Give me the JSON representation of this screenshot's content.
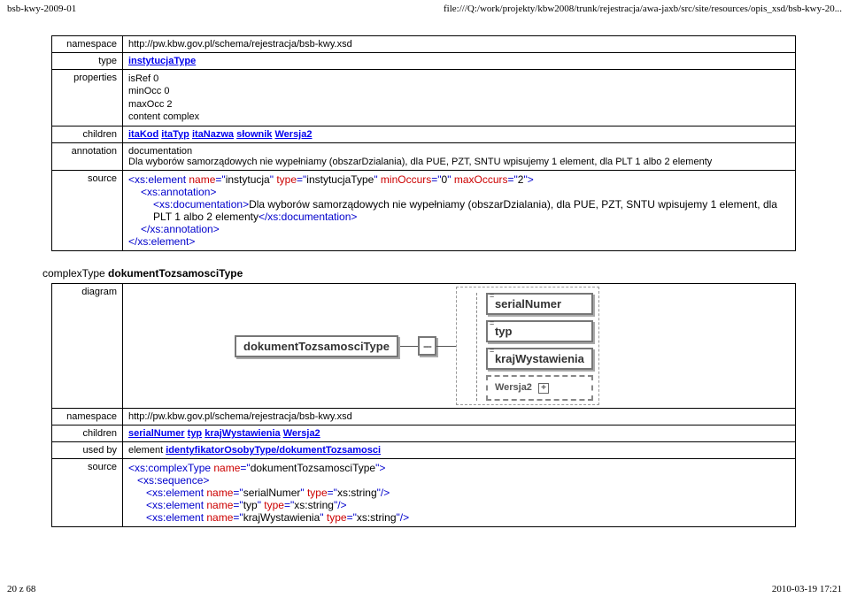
{
  "header": {
    "left": "bsb-kwy-2009-01",
    "right": "file:///Q:/work/projekty/kbw2008/trunk/rejestracja/awa-jaxb/src/site/resources/opis_xsd/bsb-kwy-20..."
  },
  "row1": {
    "label": "namespace",
    "value": "http://pw.kbw.gov.pl/schema/rejestracja/bsb-kwy.xsd"
  },
  "row2": {
    "label": "type",
    "value": "instytucjaType"
  },
  "row3": {
    "label": "properties",
    "p1": "isRef 0",
    "p2": "minOcc 0",
    "p3": "maxOcc 2",
    "p4": "content complex"
  },
  "row4": {
    "label": "children",
    "c1": "itaKod",
    "c2": "itaTyp",
    "c3": "itaNazwa",
    "c4": "słownik",
    "c5": "Wersja2"
  },
  "row5": {
    "label": "annotation",
    "line1": "documentation",
    "line2": "Dla wyborów samorządowych nie wypełniamy (obszarDzialania), dla PUE, PZT, SNTU wpisujemy 1 element, dla PLT 1 albo 2 elementy"
  },
  "row6": {
    "label": "source",
    "l1a": "<xs:element ",
    "l1b": "name",
    "l1c": "=\"",
    "l1d": "instytucja",
    "l1e": "\" ",
    "l1f": "type",
    "l1g": "=\"",
    "l1h": "instytucjaType",
    "l1i": "\" ",
    "l1j": "minOccurs",
    "l1k": "=\"",
    "l1l": "0",
    "l1m": "\" ",
    "l1n": "maxOccurs",
    "l1o": "=\"",
    "l1p": "2",
    "l1q": "\">",
    "l2": "<xs:annotation>",
    "l3a": "<xs:documentation>",
    "l3b": "Dla wyborów samorządowych nie wypełniamy (obszarDzialania), dla PUE, PZT, SNTU wpisujemy 1 element, dla PLT 1 albo 2 elementy",
    "l3c": "</xs:documentation>",
    "l4": "</xs:annotation>",
    "l5": "</xs:element>"
  },
  "section2": {
    "prefix": "complexType ",
    "name": "dokumentTozsamosciType"
  },
  "diagram": {
    "label": "diagram",
    "root": "dokumentTozsamosciType",
    "seq": "---",
    "c1": "serialNumer",
    "c2": "typ",
    "c3": "krajWystawienia",
    "c4": "Wersja2",
    "eq": "="
  },
  "row7": {
    "label": "namespace",
    "value": "http://pw.kbw.gov.pl/schema/rejestracja/bsb-kwy.xsd"
  },
  "row8": {
    "label": "children",
    "c1": "serialNumer",
    "c2": "typ",
    "c3": "krajWystawienia",
    "c4": "Wersja2"
  },
  "row9": {
    "label": "used by",
    "prefix": "element ",
    "value": "identyfikatorOsobyType/dokumentTozsamosci"
  },
  "row10": {
    "label": "source",
    "l1a": "<xs:complexType ",
    "l1b": "name",
    "l1c": "=\"",
    "l1d": "dokumentTozsamosciType",
    "l1e": "\">",
    "l2": "<xs:sequence>",
    "l3a": "<xs:element ",
    "l3b": "name",
    "l3c": "=\"",
    "l3d": "serialNumer",
    "l3e": "\" ",
    "l3f": "type",
    "l3g": "=\"",
    "l3h": "xs:string",
    "l3i": "\"/>",
    "l4a": "<xs:element ",
    "l4b": "name",
    "l4c": "=\"",
    "l4d": "typ",
    "l4e": "\" ",
    "l4f": "type",
    "l4g": "=\"",
    "l4h": "xs:string",
    "l4i": "\"/>",
    "l5a": "<xs:element ",
    "l5b": "name",
    "l5c": "=\"",
    "l5d": "krajWystawienia",
    "l5e": "\" ",
    "l5f": "type",
    "l5g": "=\"",
    "l5h": "xs:string",
    "l5i": "\"/>"
  },
  "footer": {
    "left": "20 z 68",
    "right": "2010-03-19 17:21"
  }
}
